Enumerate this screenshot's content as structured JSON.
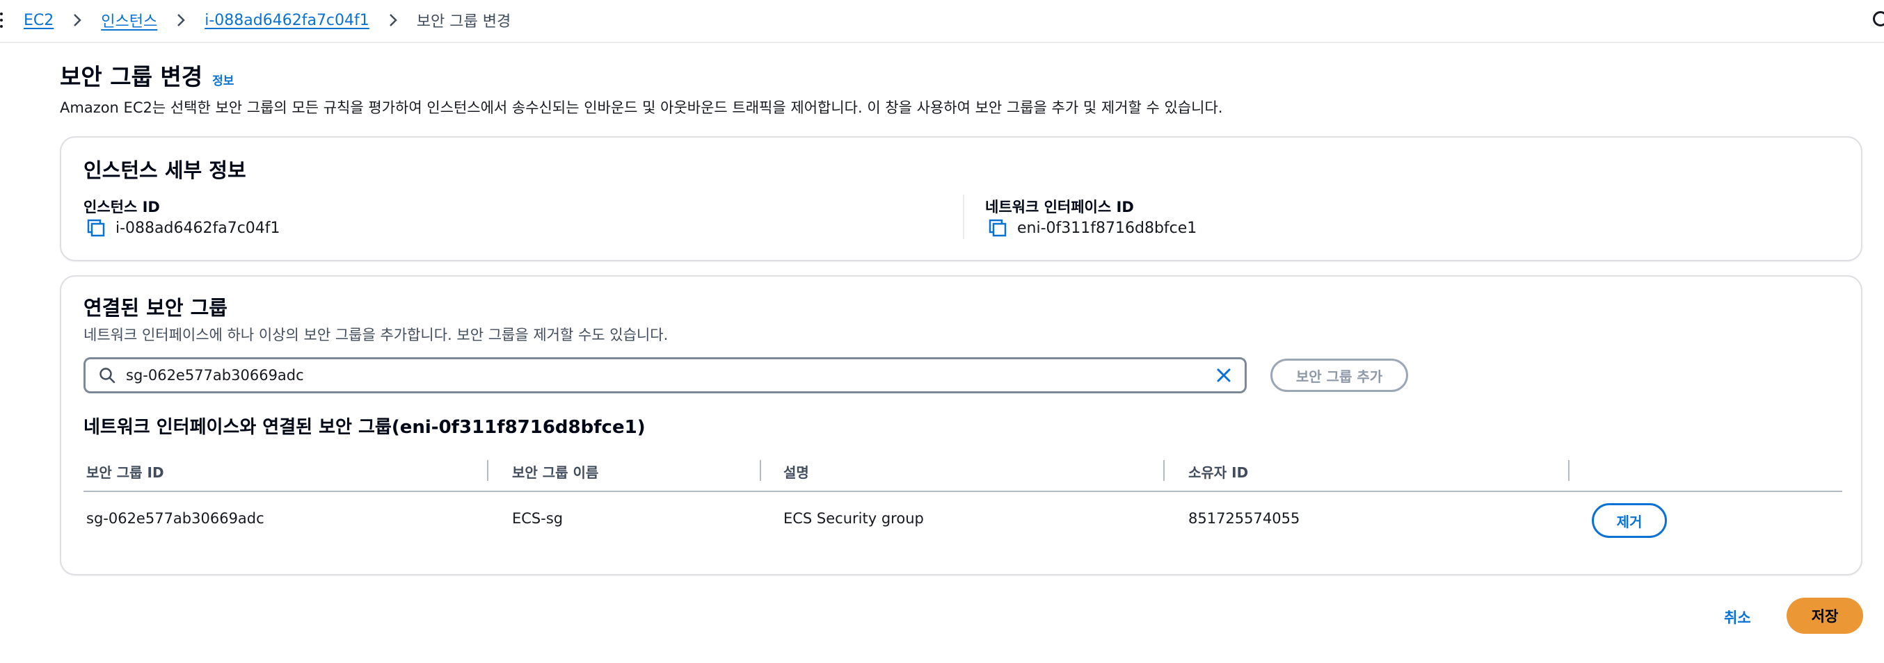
{
  "breadcrumb": {
    "items": [
      {
        "label": "EC2"
      },
      {
        "label": "인스턴스"
      },
      {
        "label": "i-088ad6462fa7c04f1"
      },
      {
        "label": "보안 그룹 변경"
      }
    ]
  },
  "header": {
    "title": "보안 그룹 변경",
    "info_link": "정보",
    "description": "Amazon EC2는 선택한 보안 그룹의 모든 규칙을 평가하여 인스턴스에서 송수신되는 인바운드 및 아웃바운드 트래픽을 제어합니다. 이 창을 사용하여 보안 그룹을 추가 및 제거할 수 있습니다."
  },
  "instance_details": {
    "title": "인스턴스 세부 정보",
    "instance_id_label": "인스턴스 ID",
    "instance_id_value": "i-088ad6462fa7c04f1",
    "eni_label": "네트워크 인터페이스 ID",
    "eni_value": "eni-0f311f8716d8bfce1"
  },
  "associated_sg": {
    "title": "연결된 보안 그룹",
    "description": "네트워크 인터페이스에 하나 이상의 보안 그룹을 추가합니다. 보안 그룹을 제거할 수도 있습니다.",
    "search_value": "sg-062e577ab30669adc",
    "add_button": "보안 그룹 추가",
    "table_title": "네트워크 인터페이스와 연결된 보안 그룹(eni-0f311f8716d8bfce1)",
    "columns": [
      "보안 그룹 ID",
      "보안 그룹 이름",
      "설명",
      "소유자 ID"
    ],
    "rows": [
      {
        "id": "sg-062e577ab30669adc",
        "name": "ECS-sg",
        "description": "ECS Security group",
        "owner": "851725574055",
        "remove_label": "제거"
      }
    ]
  },
  "footer": {
    "cancel_label": "취소",
    "save_label": "저장"
  },
  "colors": {
    "link": "#0972d3",
    "primary_button": "#ec9736",
    "border": "#dedee3"
  }
}
